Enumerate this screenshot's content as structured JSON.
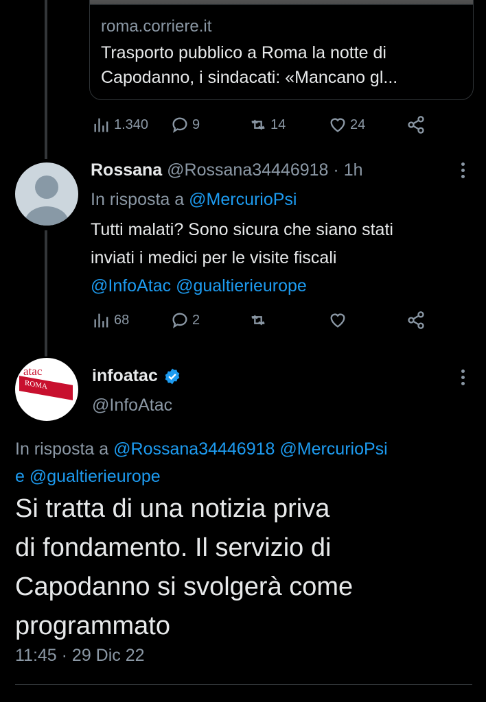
{
  "link_card": {
    "domain": "roma.corriere.it",
    "title": "Trasporto pubblico a Roma la notte di Capodanno, i sindacati: «Mancano gl..."
  },
  "tweet1_actions": {
    "views": "1.340",
    "replies": "9",
    "retweets": "14",
    "likes": "24"
  },
  "tweet2": {
    "name": "Rossana",
    "handle": "@Rossana34446918",
    "separator": "·",
    "time": "1h",
    "reply_prefix": "In risposta a",
    "reply_mention": "@MercurioPsi",
    "text_line1": "Tutti malati? Sono sicura che siano stati",
    "text_line2": "inviati i medici per le visite fiscali",
    "mention1": "@InfoAtac",
    "mention2": "@gualtierieurope",
    "views": "68",
    "replies": "2",
    "retweets": "",
    "likes": ""
  },
  "tweet3": {
    "name": "infoatac",
    "handle": "@InfoAtac",
    "logo_text_top": "atac",
    "logo_text_banner": "ROMA",
    "reply_prefix": "In risposta a",
    "reply_mention1": "@Rossana34446918",
    "reply_mention2": "@MercurioPsi",
    "reply_join": "e",
    "reply_mention3": "@gualtierieurope",
    "text_line1": "Si tratta di una notizia priva",
    "text_line2": "di fondamento. Il servizio di",
    "text_line3": "Capodanno si svolgerà come",
    "text_line4": "programmato",
    "timestamp": "11:45 · 29 Dic 22"
  },
  "colors": {
    "background": "#000000",
    "text": "#e7e9ea",
    "muted": "#8b98a5",
    "link": "#1d9bf0",
    "verified": "#1d9bf0",
    "atac_red": "#c8102e"
  }
}
